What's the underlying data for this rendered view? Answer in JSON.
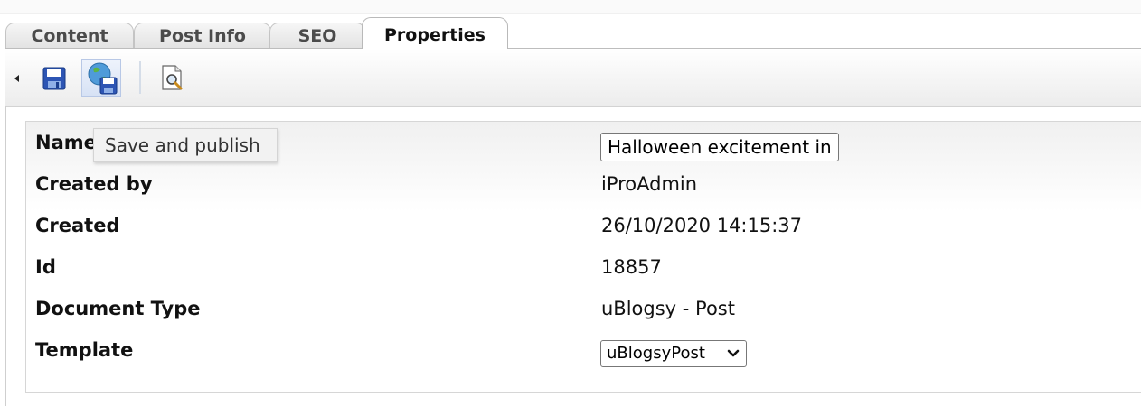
{
  "tabs": [
    {
      "label": "Content",
      "active": false
    },
    {
      "label": "Post Info",
      "active": false
    },
    {
      "label": "SEO",
      "active": false
    },
    {
      "label": "Properties",
      "active": true
    }
  ],
  "toolbar": {
    "buttons": [
      {
        "icon": "save-icon"
      },
      {
        "icon": "save-and-publish-icon",
        "pressed": true
      },
      {
        "icon": "preview-icon"
      }
    ],
    "tooltip": "Save and publish"
  },
  "properties": {
    "name_label": "Name",
    "name_value": "Halloween excitement in",
    "created_by_label": "Created by",
    "created_by_value": "iProAdmin",
    "created_label": "Created",
    "created_value": "26/10/2020 14:15:37",
    "id_label": "Id",
    "id_value": "18857",
    "doctype_label": "Document Type",
    "doctype_value": "uBlogsy - Post",
    "template_label": "Template",
    "template_value": "uBlogsyPost"
  },
  "colors": {
    "tab_border": "#c4c4c4",
    "save_icon_blue": "#2d55b4",
    "tooltip_bg": "#f2f2f2"
  }
}
